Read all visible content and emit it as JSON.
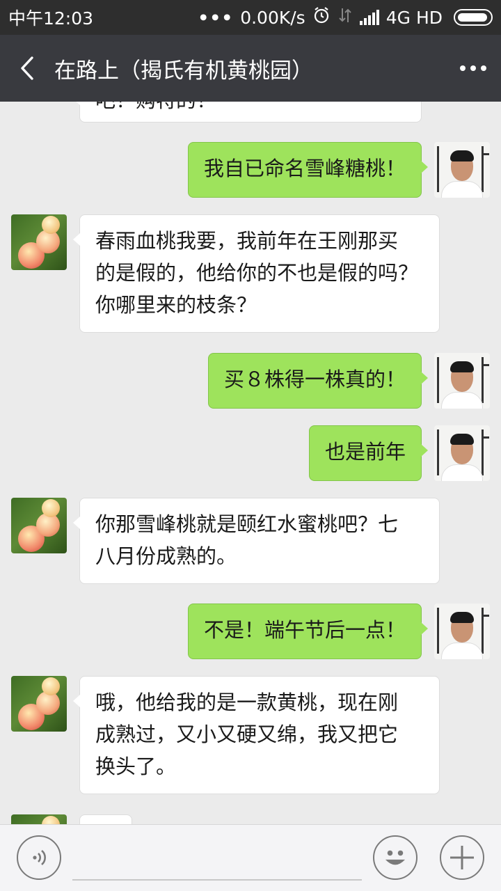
{
  "status_bar": {
    "time": "中午12:03",
    "dots": "•••",
    "net_speed": "0.00K/s",
    "network": "4G HD"
  },
  "header": {
    "title": "在路上（揭氏有机黄桃园）"
  },
  "messages": [
    {
      "side": "recv",
      "text": "吧！购特的！"
    },
    {
      "side": "sent",
      "text": "我自已命名雪峰糖桃！"
    },
    {
      "side": "recv",
      "lines": [
        "春雨血桃我要，我前年在王刚那买",
        "的是假的，他给你的不也是假的吗？",
        "你哪里来的枝条？"
      ]
    },
    {
      "side": "sent",
      "text": "买８株得一株真的！"
    },
    {
      "side": "sent",
      "text": "也是前年"
    },
    {
      "side": "recv",
      "lines": [
        "你那雪峰桃就是颐红水蜜桃吧？七",
        "八月份成熟的。"
      ]
    },
    {
      "side": "sent",
      "text": "不是！端午节后一点！"
    },
    {
      "side": "recv",
      "lines": [
        "哦，他给我的是一款黄桃，现在刚",
        "成熟过，又小又硬又绵，我又把它",
        "换头了。"
      ]
    },
    {
      "side": "recv",
      "text": ""
    }
  ],
  "icons": {
    "back": "back-arrow-icon",
    "more": "more-options-icon",
    "voice": "voice-icon",
    "emoji": "emoji-icon",
    "plus": "plus-icon",
    "alarm": "alarm-icon",
    "signal": "signal-icon",
    "battery": "battery-icon"
  },
  "colors": {
    "sent_bubble": "#9ee35c",
    "recv_bubble": "#ffffff",
    "header": "#393a3f",
    "background": "#ebebeb"
  }
}
